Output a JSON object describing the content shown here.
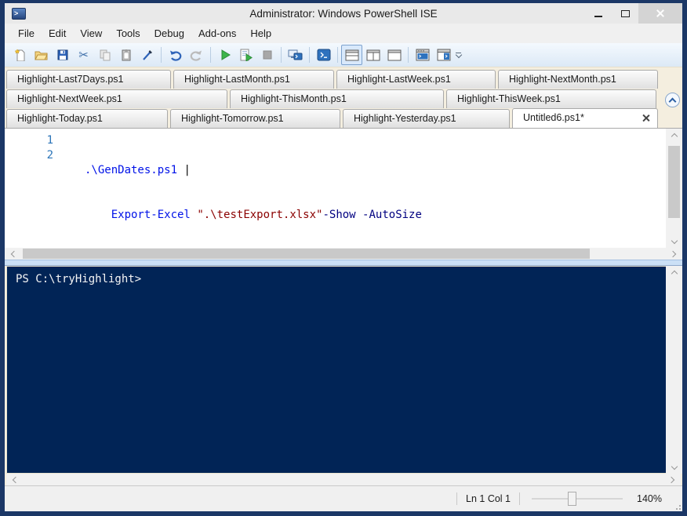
{
  "window": {
    "title": "Administrator: Windows PowerShell ISE",
    "app_icon": "powershell-icon"
  },
  "menu": {
    "items": [
      "File",
      "Edit",
      "View",
      "Tools",
      "Debug",
      "Add-ons",
      "Help"
    ]
  },
  "toolbar": {
    "icons": [
      "new-script-icon",
      "open-script-icon",
      "save-icon",
      "cut-icon",
      "copy-icon",
      "paste-icon",
      "clear-console-icon",
      "undo-icon",
      "redo-icon",
      "run-script-icon",
      "run-selection-icon",
      "stop-operation-icon",
      "new-remote-powershell-tab-icon",
      "start-powershell-icon",
      "show-script-pane-top-icon",
      "show-script-pane-right-icon",
      "show-script-pane-maximized-icon",
      "console-window-icon",
      "command-addon-icon",
      "toolbar-overflow-icon"
    ]
  },
  "tabs": {
    "row1": [
      "Highlight-Last7Days.ps1",
      "Highlight-LastMonth.ps1",
      "Highlight-LastWeek.ps1",
      "Highlight-NextMonth.ps1"
    ],
    "row2": [
      "Highlight-NextWeek.ps1",
      "Highlight-ThisMonth.ps1",
      "Highlight-ThisWeek.ps1"
    ],
    "row3": [
      "Highlight-Today.ps1",
      "Highlight-Tomorrow.ps1",
      "Highlight-Yesterday.ps1"
    ],
    "active": "Untitled6.ps1*"
  },
  "editor": {
    "lines": [
      {
        "number": "1",
        "tokens": [
          {
            "text": ".\\GenDates.ps1",
            "type": "command"
          },
          {
            "text": " |",
            "type": "default"
          }
        ]
      },
      {
        "number": "2",
        "tokens": [
          {
            "text": "    ",
            "type": "default"
          },
          {
            "text": "Export-Excel",
            "type": "command"
          },
          {
            "text": " ",
            "type": "default"
          },
          {
            "text": "\".\\testExport.xlsx\"",
            "type": "string"
          },
          {
            "text": "-Show",
            "type": "parameter"
          },
          {
            "text": " -AutoSize",
            "type": "parameter"
          }
        ]
      }
    ]
  },
  "console": {
    "prompt": "PS C:\\tryHighlight>"
  },
  "statusbar": {
    "position": "Ln 1 Col 1",
    "zoom": "140%"
  },
  "colors": {
    "window_border": "#1B3766",
    "console_background": "#012456",
    "command_text": "#0012E8",
    "string_text": "#8B0000",
    "parameter_text": "#000080",
    "line_number": "#2B74B8",
    "run_green": "#3CB44A",
    "save_blue": "#2E63B8"
  }
}
